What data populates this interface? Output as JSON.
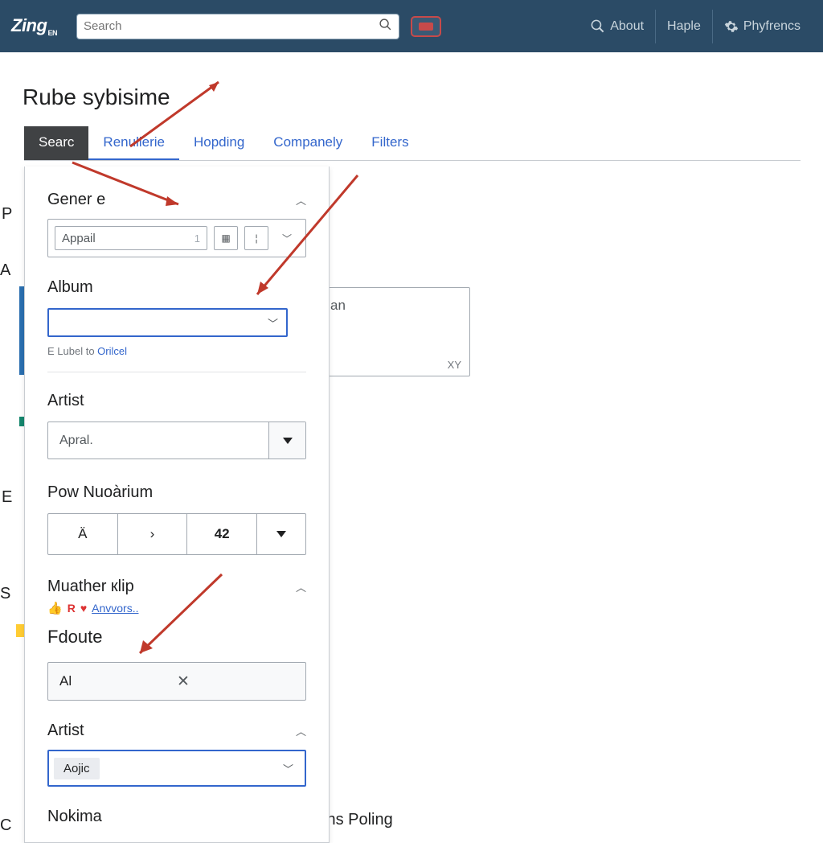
{
  "header": {
    "logo": "Zing",
    "logo_sub": "EN",
    "search_placeholder": "Search",
    "about": "About",
    "haple": "Haple",
    "prefs": "Phyfrencs"
  },
  "page_title": "Rube sybisime",
  "tabs": {
    "t1": "Searc",
    "t2": "Renullerie",
    "t3": "Hopding",
    "t4": "Companely",
    "t5": "Filters"
  },
  "panel": {
    "genre_title": "Gener e",
    "genre_value": "Appail",
    "genre_numeral": "1",
    "album_title": "Album",
    "helper_prefix": "E Lubel to ",
    "helper_link": "Orilcel",
    "artist_title": "Artist",
    "artist_value": "Apral.",
    "pow_title": "Pow Nuoàrium",
    "seg1": "Ä",
    "seg2": "›",
    "seg3": "42",
    "muather_title": "Muather кlip",
    "fav_r": "R",
    "fav_link": "Anvvors..",
    "fdoute_title": "Fdoute",
    "fdoute_value": "Al",
    "artist2_title": "Artist",
    "artist2_chip": "Aojic",
    "nokima_title": "Nokima"
  },
  "bg": {
    "letter_p": "P",
    "letter_a": "A",
    "letter_e": "E",
    "letter_s": "S",
    "letter_c": "C",
    "textarea_hint": "an",
    "xy": "XY",
    "bottom": "ins Poling"
  }
}
